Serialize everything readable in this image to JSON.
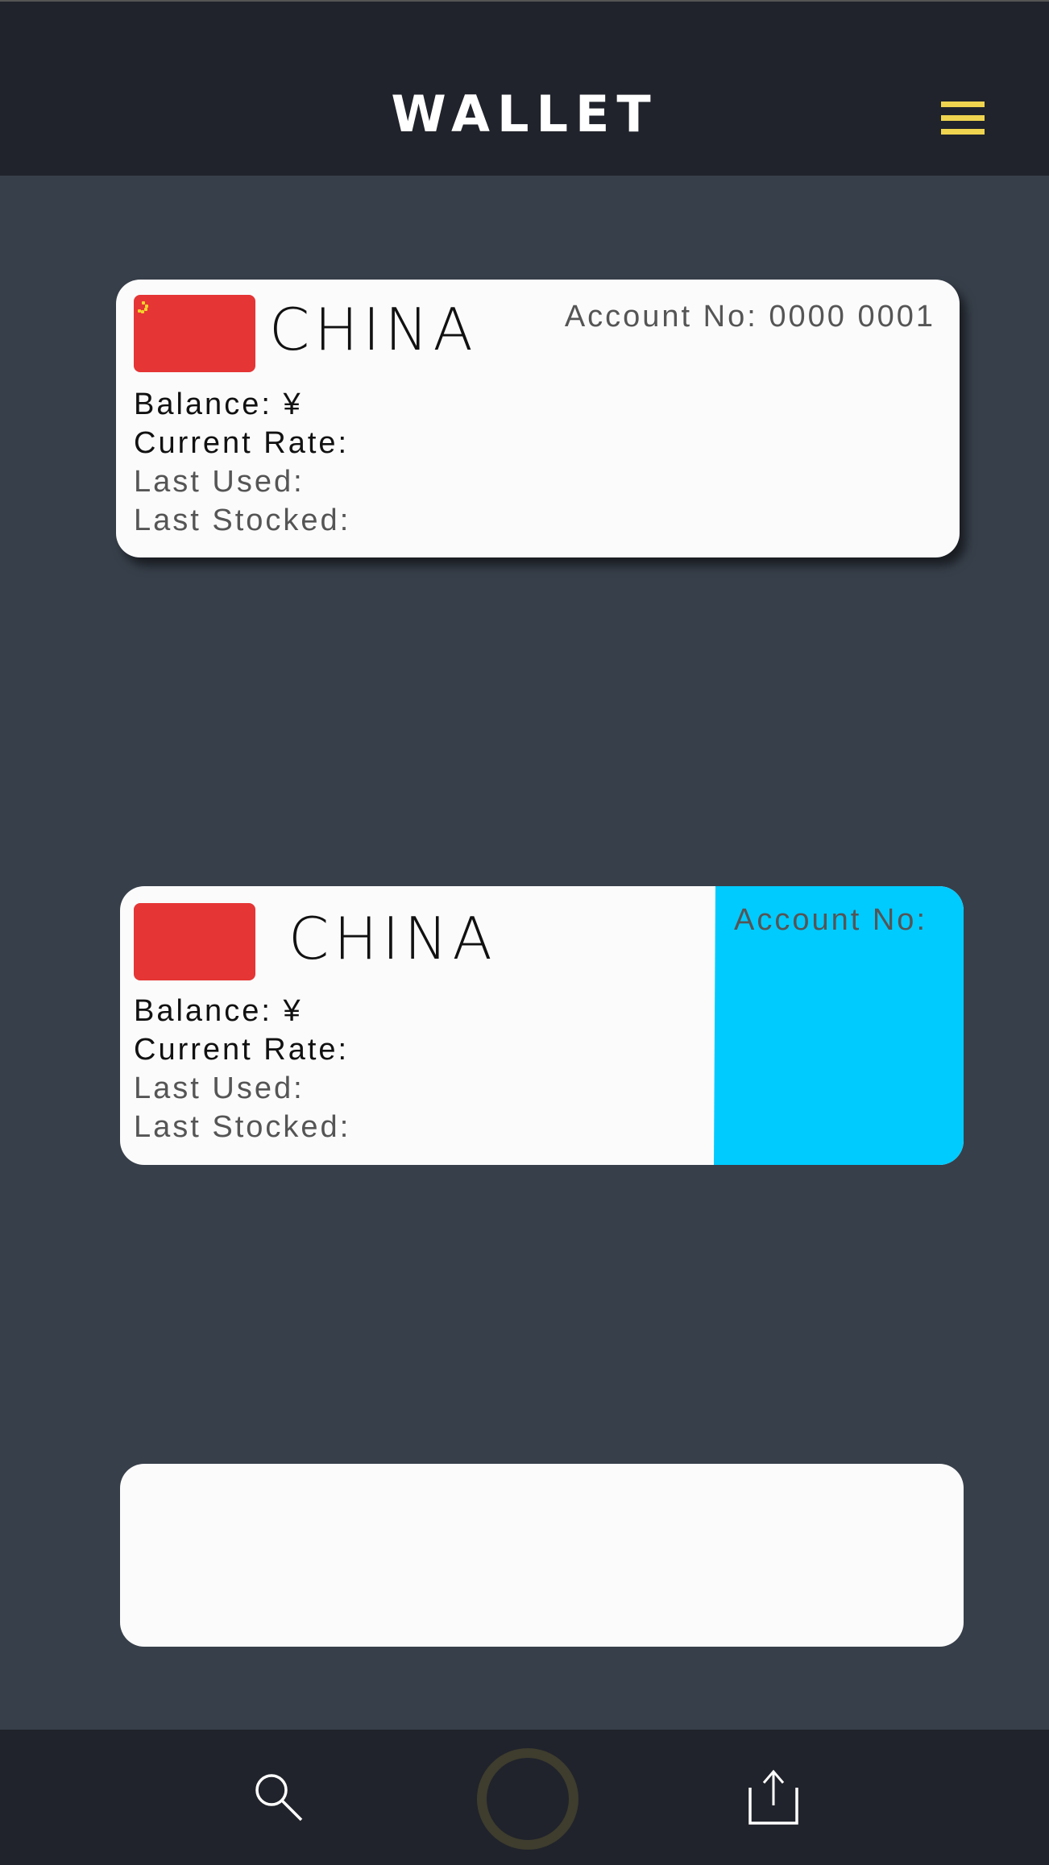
{
  "header": {
    "title": "WALLET",
    "menu_icon": "hamburger-menu-icon",
    "menu_color": "#efd44f"
  },
  "cards": [
    {
      "country": "CHINA",
      "account_label": "Account No: 0000 0001",
      "balance": "Balance: ¥",
      "current_rate": "Current Rate:",
      "last_used": "Last Used:",
      "last_stocked": "Last Stocked:",
      "flag": "china-flag"
    },
    {
      "country": "CHINA",
      "account_label": "Account No:",
      "balance": "Balance: ¥",
      "current_rate": "Current Rate:",
      "last_used": "Last Used:",
      "last_stocked": "Last Stocked:",
      "flag": "china-flag",
      "accent_color": "#00cbff"
    },
    {}
  ],
  "bottom_nav": {
    "items": [
      "search-icon",
      "home-circle-icon",
      "share-icon"
    ]
  }
}
